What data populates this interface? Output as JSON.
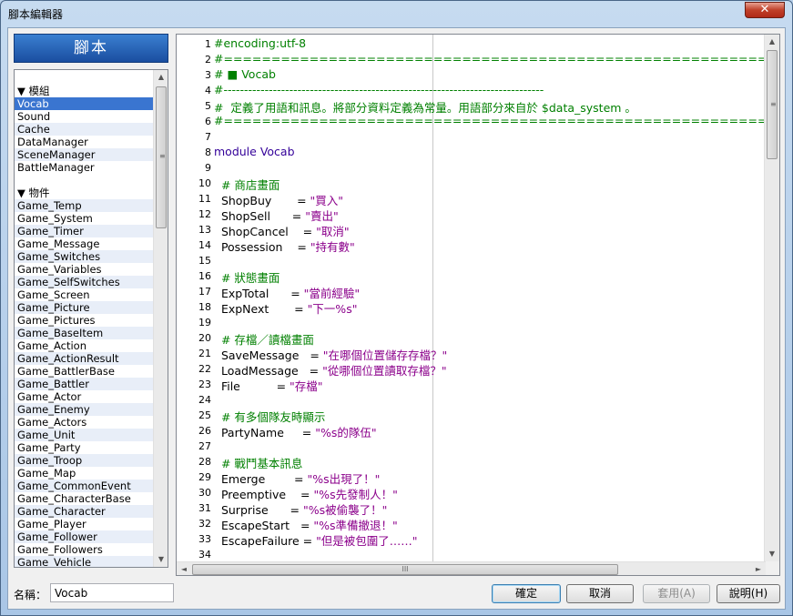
{
  "window": {
    "title": "腳本編輯器",
    "close_glyph": "✕"
  },
  "header": {
    "label": "腳本"
  },
  "list": [
    {
      "label": "▼ 模組",
      "kind": "section"
    },
    {
      "label": "Vocab",
      "kind": "selected"
    },
    {
      "label": "Sound"
    },
    {
      "label": "Cache"
    },
    {
      "label": "DataManager"
    },
    {
      "label": "SceneManager"
    },
    {
      "label": "BattleManager"
    },
    {
      "label": "",
      "kind": "blank"
    },
    {
      "label": "▼ 物件",
      "kind": "section"
    },
    {
      "label": "Game_Temp"
    },
    {
      "label": "Game_System"
    },
    {
      "label": "Game_Timer"
    },
    {
      "label": "Game_Message"
    },
    {
      "label": "Game_Switches"
    },
    {
      "label": "Game_Variables"
    },
    {
      "label": "Game_SelfSwitches"
    },
    {
      "label": "Game_Screen"
    },
    {
      "label": "Game_Picture"
    },
    {
      "label": "Game_Pictures"
    },
    {
      "label": "Game_BaseItem"
    },
    {
      "label": "Game_Action"
    },
    {
      "label": "Game_ActionResult"
    },
    {
      "label": "Game_BattlerBase"
    },
    {
      "label": "Game_Battler"
    },
    {
      "label": "Game_Actor"
    },
    {
      "label": "Game_Enemy"
    },
    {
      "label": "Game_Actors"
    },
    {
      "label": "Game_Unit"
    },
    {
      "label": "Game_Party"
    },
    {
      "label": "Game_Troop"
    },
    {
      "label": "Game_Map"
    },
    {
      "label": "Game_CommonEvent"
    },
    {
      "label": "Game_CharacterBase"
    },
    {
      "label": "Game_Character"
    },
    {
      "label": "Game_Player"
    },
    {
      "label": "Game_Follower"
    },
    {
      "label": "Game_Followers"
    },
    {
      "label": "Game_Vehicle"
    }
  ],
  "name_field": {
    "label": "名稱：",
    "value": "Vocab"
  },
  "code": [
    {
      "n": "1",
      "text": "#encoding:utf-8",
      "cls": "c-comment"
    },
    {
      "n": "2",
      "text": "#==============================================================================",
      "cls": "c-comment"
    },
    {
      "n": "3",
      "text": "# ■ Vocab",
      "cls": "c-comment"
    },
    {
      "n": "4",
      "text": "#------------------------------------------------------------------------------",
      "cls": "c-comment"
    },
    {
      "n": "5",
      "text": "#  定義了用語和訊息。將部分資料定義為常量。用語部分來自於 $data_system 。",
      "cls": "c-comment"
    },
    {
      "n": "6",
      "text": "#==============================================================================",
      "cls": "c-comment"
    },
    {
      "n": "7",
      "text": "",
      "cls": ""
    },
    {
      "n": "8",
      "text": "module Vocab",
      "cls": "c-kw"
    },
    {
      "n": "9",
      "text": "",
      "cls": ""
    },
    {
      "n": "10",
      "text": "  # 商店畫面",
      "cls": "c-comment"
    },
    {
      "n": "11",
      "key": "  ShopBuy       = ",
      "str": "\"買入\""
    },
    {
      "n": "12",
      "key": "  ShopSell      = ",
      "str": "\"賣出\""
    },
    {
      "n": "13",
      "key": "  ShopCancel    = ",
      "str": "\"取消\""
    },
    {
      "n": "14",
      "key": "  Possession    = ",
      "str": "\"持有數\""
    },
    {
      "n": "15",
      "text": "",
      "cls": ""
    },
    {
      "n": "16",
      "text": "  # 狀態畫面",
      "cls": "c-comment"
    },
    {
      "n": "17",
      "key": "  ExpTotal      = ",
      "str": "\"當前經驗\""
    },
    {
      "n": "18",
      "key": "  ExpNext       = ",
      "str": "\"下一%s\""
    },
    {
      "n": "19",
      "text": "",
      "cls": ""
    },
    {
      "n": "20",
      "text": "  # 存檔／讀檔畫面",
      "cls": "c-comment"
    },
    {
      "n": "21",
      "key": "  SaveMessage   = ",
      "str": "\"在哪個位置儲存存檔？\""
    },
    {
      "n": "22",
      "key": "  LoadMessage   = ",
      "str": "\"從哪個位置讀取存檔？\""
    },
    {
      "n": "23",
      "key": "  File          = ",
      "str": "\"存檔\""
    },
    {
      "n": "24",
      "text": "",
      "cls": ""
    },
    {
      "n": "25",
      "text": "  # 有多個隊友時顯示",
      "cls": "c-comment"
    },
    {
      "n": "26",
      "key": "  PartyName     = ",
      "str": "\"%s的隊伍\""
    },
    {
      "n": "27",
      "text": "",
      "cls": ""
    },
    {
      "n": "28",
      "text": "  # 戰鬥基本訊息",
      "cls": "c-comment"
    },
    {
      "n": "29",
      "key": "  Emerge        = ",
      "str": "\"%s出現了！\""
    },
    {
      "n": "30",
      "key": "  Preemptive    = ",
      "str": "\"%s先發制人！\""
    },
    {
      "n": "31",
      "key": "  Surprise      = ",
      "str": "\"%s被偷襲了！\""
    },
    {
      "n": "32",
      "key": "  EscapeStart   = ",
      "str": "\"%s準備撤退！\""
    },
    {
      "n": "33",
      "key": "  EscapeFailure = ",
      "str": "\"但是被包圍了……\""
    },
    {
      "n": "34",
      "text": "",
      "cls": ""
    }
  ],
  "buttons": {
    "ok": "確定",
    "cancel": "取消",
    "apply": "套用(A)",
    "help": "說明(H)"
  },
  "icons": {
    "up": "▲",
    "down": "▼",
    "left": "◄",
    "right": "►",
    "grip_v": "≡",
    "grip_h": "III"
  }
}
